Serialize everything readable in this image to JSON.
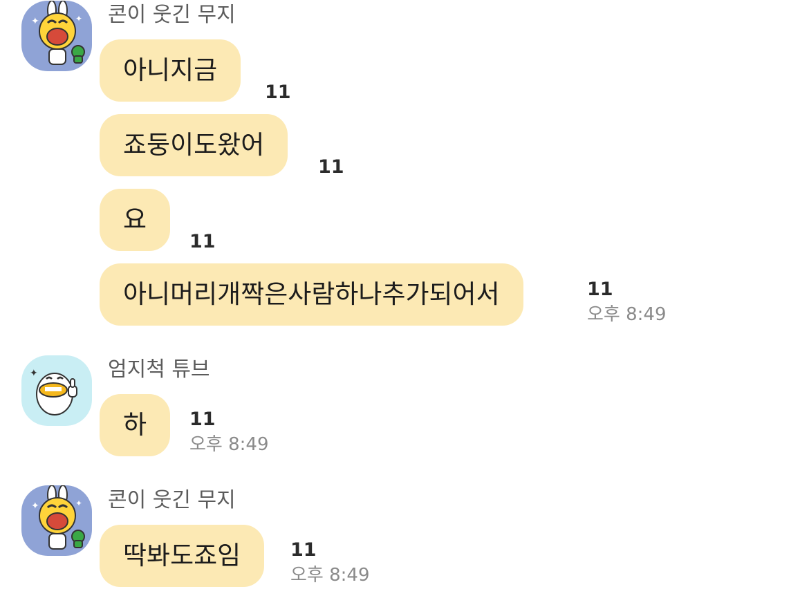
{
  "messages_group_1": {
    "sender": "콘이 웃긴 무지",
    "avatar_icon": "muzi-con-laughing-icon",
    "bubbles": [
      {
        "text": "아니지금",
        "unread": "11"
      },
      {
        "text": "죠둥이도왔어",
        "unread": "11"
      },
      {
        "text": "요",
        "unread": "11"
      },
      {
        "text": "아니머리개짝은사람하나추가되어서",
        "unread": "11",
        "time": "오후 8:49"
      }
    ]
  },
  "messages_group_2": {
    "sender": "엄지척 튜브",
    "avatar_icon": "tube-thumbs-up-icon",
    "bubbles": [
      {
        "text": "하",
        "unread": "11",
        "time": "오후 8:49"
      }
    ]
  },
  "messages_group_3": {
    "sender": "콘이 웃긴 무지",
    "avatar_icon": "muzi-con-laughing-icon",
    "bubbles": [
      {
        "text": "딱봐도죠임",
        "unread": "11",
        "time": "오후 8:49"
      }
    ]
  },
  "colors": {
    "bubble": "#fce9b4",
    "unread_count": "#2b2b2b",
    "time": "#8a8a8a",
    "sender": "#5b5b5b"
  }
}
